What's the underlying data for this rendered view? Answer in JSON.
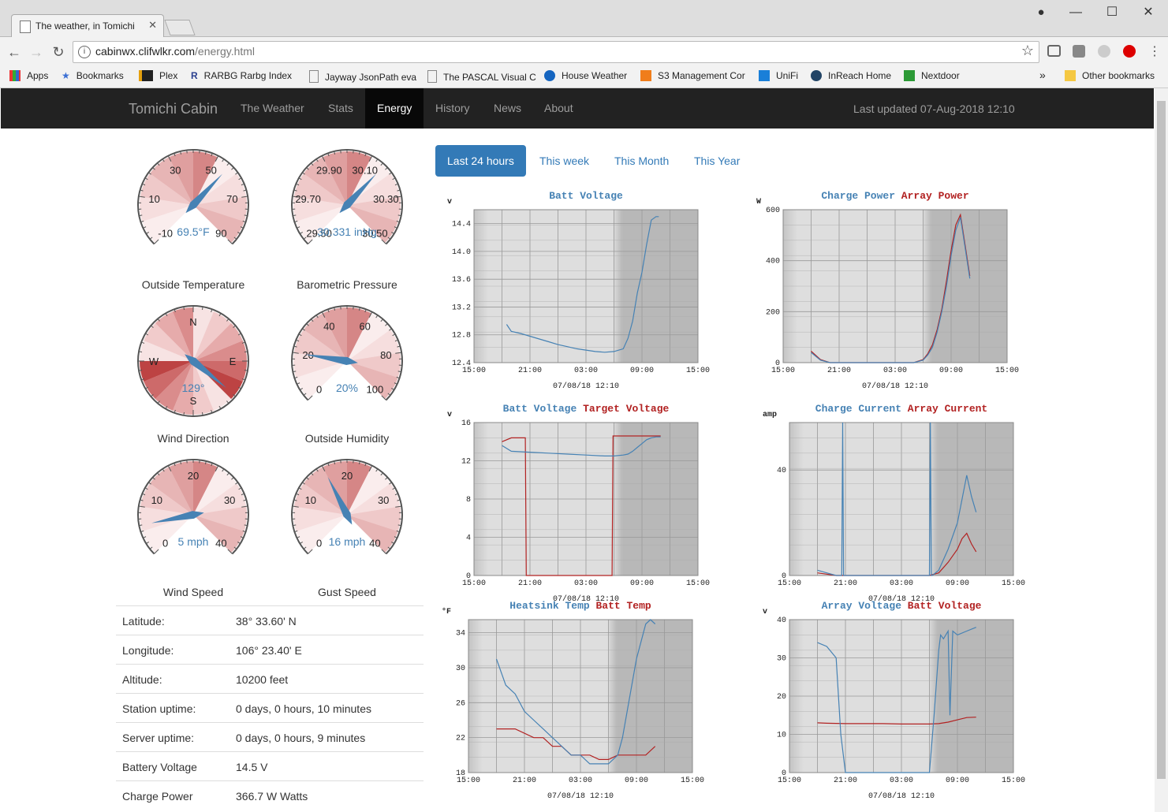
{
  "browser": {
    "tab_title": "The weather, in Tomichi",
    "url_host": "cabinwx.clifwlkr.com",
    "url_path": "/energy.html",
    "bookmarks": [
      "Apps",
      "Bookmarks",
      "Plex",
      "RARBG Rarbg Index",
      "Jayway JsonPath eva",
      "The PASCAL Visual C",
      "House Weather",
      "S3 Management Cor",
      "UniFi",
      "InReach Home",
      "Nextdoor"
    ],
    "overflow": "»",
    "other_bookmarks": "Other bookmarks"
  },
  "navbar": {
    "brand": "Tomichi Cabin",
    "items": [
      "The Weather",
      "Stats",
      "Energy",
      "History",
      "News",
      "About"
    ],
    "active": "Energy",
    "updated": "Last updated 07-Aug-2018 12:10"
  },
  "gauges": [
    {
      "label": "Outside Temperature",
      "value": "69.5°F",
      "ticks": [
        "-10",
        "10",
        "30",
        "50",
        "70",
        "90"
      ],
      "needle_fraction": 0.66
    },
    {
      "label": "Barometric Pressure",
      "value": "30.331 inHg",
      "ticks": [
        "29.50",
        "29.70",
        "29.90",
        "30.10",
        "30.30",
        "30.50"
      ],
      "needle_fraction": 0.66
    },
    {
      "label": "Wind Direction",
      "value": "129°",
      "ticks": [
        "N",
        "E",
        "S",
        "W"
      ],
      "needle_degrees": 129
    },
    {
      "label": "Outside Humidity",
      "value": "20%",
      "ticks": [
        "0",
        "20",
        "40",
        "60",
        "80",
        "100"
      ],
      "needle_fraction": 0.2
    },
    {
      "label": "Wind Speed",
      "value": "5 mph",
      "ticks": [
        "0",
        "10",
        "20",
        "30",
        "40"
      ],
      "needle_fraction": 0.125
    },
    {
      "label": "Gust Speed",
      "value": "16 mph",
      "ticks": [
        "0",
        "10",
        "20",
        "30",
        "40"
      ],
      "needle_fraction": 0.4
    }
  ],
  "station": [
    {
      "key": "Latitude:",
      "value": "38° 33.60' N"
    },
    {
      "key": "Longitude:",
      "value": "106° 23.40' E"
    },
    {
      "key": "Altitude:",
      "value": "10200 feet"
    },
    {
      "key": "Station uptime:",
      "value": "0 days, 0 hours, 10 minutes"
    },
    {
      "key": "Server uptime:",
      "value": "0 days, 0 hours, 9 minutes"
    },
    {
      "key": "Battery Voltage",
      "value": "14.5 V"
    },
    {
      "key": "Charge Power",
      "value": "366.7 W Watts"
    }
  ],
  "periods": [
    "Last 24 hours",
    "This week",
    "This Month",
    "This Year"
  ],
  "active_period": "Last 24 hours",
  "colors": {
    "blue": "#4682b4",
    "red": "#b22222",
    "brand": "#337ab7"
  },
  "chart_data": [
    {
      "type": "line",
      "unit": "v",
      "title_parts": [
        "Batt Voltage"
      ],
      "xticks": [
        "15:00",
        "21:00",
        "03:00",
        "09:00",
        "15:00"
      ],
      "yticks": [
        "12.4",
        "12.8",
        "13.2",
        "13.6",
        "14.0",
        "14.4"
      ],
      "ylim": [
        12.4,
        14.6
      ],
      "date": "07/08/18 12:10",
      "series": [
        {
          "name": "Batt Voltage",
          "x": [
            3.5,
            4,
            5,
            6,
            7,
            8,
            9,
            10,
            11,
            12,
            13,
            14,
            15,
            16,
            16.5,
            17,
            17.5,
            18,
            18.5,
            19,
            19.5,
            19.8
          ],
          "y": [
            12.95,
            12.85,
            12.82,
            12.78,
            12.74,
            12.7,
            12.66,
            12.63,
            12.6,
            12.58,
            12.56,
            12.55,
            12.56,
            12.6,
            12.75,
            13.0,
            13.4,
            13.7,
            14.1,
            14.45,
            14.5,
            14.5
          ]
        }
      ]
    },
    {
      "type": "line",
      "unit": "W",
      "title_parts": [
        "Charge Power",
        "Array Power"
      ],
      "xticks": [
        "15:00",
        "21:00",
        "03:00",
        "09:00",
        "15:00"
      ],
      "yticks": [
        "0",
        "200",
        "400",
        "600"
      ],
      "ylim": [
        0,
        600
      ],
      "date": "07/08/18 12:10",
      "series": [
        {
          "name": "Charge Power",
          "x": [
            3,
            4,
            5,
            6,
            12,
            14,
            15,
            15.5,
            16,
            16.5,
            17,
            17.5,
            18,
            18.5,
            19,
            19.5,
            20
          ],
          "y": [
            40,
            10,
            0,
            0,
            0,
            0,
            10,
            30,
            60,
            120,
            200,
            300,
            420,
            520,
            570,
            450,
            330
          ]
        },
        {
          "name": "Array Power",
          "x": [
            3,
            4,
            5,
            6,
            12,
            14,
            15,
            15.5,
            16,
            16.5,
            17,
            17.5,
            18,
            18.5,
            19,
            19.5,
            20
          ],
          "y": [
            45,
            12,
            0,
            0,
            0,
            0,
            12,
            35,
            70,
            130,
            210,
            320,
            440,
            540,
            580,
            460,
            340
          ]
        }
      ]
    },
    {
      "type": "line",
      "unit": "v",
      "title_parts": [
        "Batt Voltage",
        "Target Voltage"
      ],
      "xticks": [
        "15:00",
        "21:00",
        "03:00",
        "09:00",
        "15:00"
      ],
      "yticks": [
        "0",
        "4",
        "8",
        "12",
        "16"
      ],
      "ylim": [
        0,
        16
      ],
      "date": "07/08/18 12:10",
      "series": [
        {
          "name": "Batt Voltage",
          "x": [
            3,
            4,
            6,
            8,
            10,
            12,
            14,
            15,
            16,
            16.5,
            17,
            17.5,
            18,
            18.5,
            19,
            19.5,
            20
          ],
          "y": [
            13.6,
            13.0,
            12.9,
            12.8,
            12.7,
            12.6,
            12.5,
            12.5,
            12.6,
            12.7,
            13.0,
            13.4,
            13.8,
            14.2,
            14.4,
            14.5,
            14.5
          ]
        },
        {
          "name": "Target Voltage",
          "x": [
            3,
            4,
            5.5,
            5.6,
            6,
            14.8,
            14.9,
            15.5,
            16,
            17,
            18,
            20
          ],
          "y": [
            14,
            14.4,
            14.4,
            0,
            0,
            0,
            14.6,
            14.6,
            14.6,
            14.6,
            14.6,
            14.6
          ]
        }
      ]
    },
    {
      "type": "line",
      "unit": "amp",
      "title_parts": [
        "Charge Current",
        "Array Current"
      ],
      "xticks": [
        "15:00",
        "21:00",
        "03:00",
        "09:00",
        "15:00"
      ],
      "yticks": [
        "0",
        "40"
      ],
      "ylim": [
        0,
        58
      ],
      "date": "07/08/18 12:10",
      "series": [
        {
          "name": "Charge Current",
          "x": [
            3,
            4,
            5,
            5.6,
            5.7,
            5.8,
            6,
            6.5,
            15,
            15.1,
            15.2,
            15.3,
            16,
            17,
            18,
            19,
            19.5,
            20
          ],
          "y": [
            2,
            1,
            0,
            0,
            58,
            0,
            0,
            0,
            0,
            58,
            0,
            0,
            2,
            10,
            20,
            38,
            30,
            24
          ]
        },
        {
          "name": "Array Current",
          "x": [
            3,
            4,
            5,
            6,
            15,
            16,
            17,
            18,
            18.5,
            19,
            19.5,
            20
          ],
          "y": [
            1,
            0.5,
            0,
            0,
            0,
            1,
            5,
            10,
            14,
            16,
            12,
            9
          ]
        }
      ]
    },
    {
      "type": "line",
      "unit": "°F",
      "title_parts": [
        "Heatsink Temp",
        "Batt Temp"
      ],
      "xticks": [
        "15:00",
        "21:00",
        "03:00",
        "09:00",
        "15:00"
      ],
      "yticks": [
        "18",
        "22",
        "26",
        "30",
        "34"
      ],
      "ylim": [
        18,
        35.5
      ],
      "date": "07/08/18 12:10",
      "series": [
        {
          "name": "Heatsink Temp",
          "x": [
            3,
            4,
            5,
            6,
            7,
            8,
            9,
            10,
            11,
            12,
            13,
            14,
            15,
            16,
            16.5,
            17,
            17.5,
            18,
            18.5,
            19,
            19.5,
            20
          ],
          "y": [
            31,
            28,
            27,
            25,
            24,
            23,
            22,
            21,
            20,
            20,
            19,
            19,
            19,
            20,
            22,
            25,
            28,
            31,
            33,
            35,
            35.5,
            35
          ]
        },
        {
          "name": "Batt Temp",
          "x": [
            3,
            5,
            7,
            8,
            9,
            10,
            11,
            12,
            13,
            14,
            15,
            16,
            17,
            18,
            19,
            20
          ],
          "y": [
            23,
            23,
            22,
            22,
            21,
            21,
            20,
            20,
            20,
            19.5,
            19.5,
            20,
            20,
            20,
            20,
            21
          ]
        }
      ]
    },
    {
      "type": "line",
      "unit": "v",
      "title_parts": [
        "Array Voltage",
        "Batt Voltage"
      ],
      "xticks": [
        "15:00",
        "21:00",
        "03:00",
        "09:00",
        "15:00"
      ],
      "yticks": [
        "0",
        "10",
        "20",
        "30",
        "40"
      ],
      "ylim": [
        0,
        40
      ],
      "date": "07/08/18 12:10",
      "series": [
        {
          "name": "Array Voltage",
          "x": [
            3,
            4,
            5,
            5.5,
            6,
            7,
            8,
            9,
            10,
            11,
            12,
            13,
            14,
            15,
            15.5,
            16,
            16.2,
            16.5,
            17,
            17.2,
            17.5,
            18,
            19,
            20
          ],
          "y": [
            34,
            33,
            30,
            10,
            0,
            0,
            0,
            0,
            0,
            0,
            0,
            0,
            0,
            0,
            15,
            32,
            36,
            35,
            37,
            15,
            37,
            36,
            37,
            38
          ]
        },
        {
          "name": "Batt Voltage",
          "x": [
            3,
            4,
            6,
            8,
            10,
            12,
            14,
            15,
            16,
            17,
            18,
            19,
            20
          ],
          "y": [
            13,
            12.9,
            12.8,
            12.8,
            12.8,
            12.7,
            12.7,
            12.7,
            12.8,
            13.2,
            13.8,
            14.4,
            14.5
          ]
        }
      ]
    }
  ]
}
